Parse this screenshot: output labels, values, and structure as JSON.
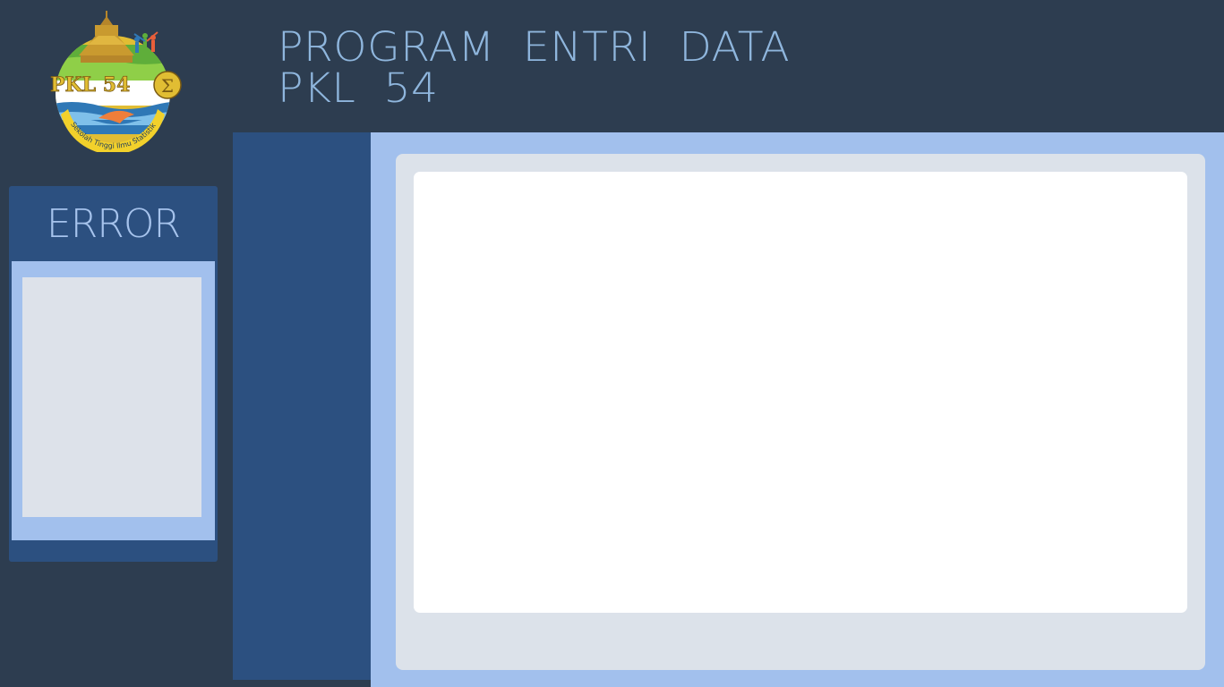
{
  "app": {
    "title_line1": "PROGRAM  ENTRI  DATA",
    "title_line2": "PKL  54"
  },
  "logo": {
    "text": "PKL 54",
    "symbol": "Σ",
    "ring_text": "Sekolah Tinggi Ilmu Statistik",
    "icon": "pkl54-logo"
  },
  "error_panel": {
    "title": "ERROR",
    "message": ""
  },
  "colors": {
    "background": "#2d3d50",
    "panel": "#2c5080",
    "accent_light": "#a2c0ed",
    "title_text": "#8fb6dd",
    "content_gray": "#dce2ea",
    "content_white": "#ffffff",
    "logo_gold": "#d9b33c"
  }
}
